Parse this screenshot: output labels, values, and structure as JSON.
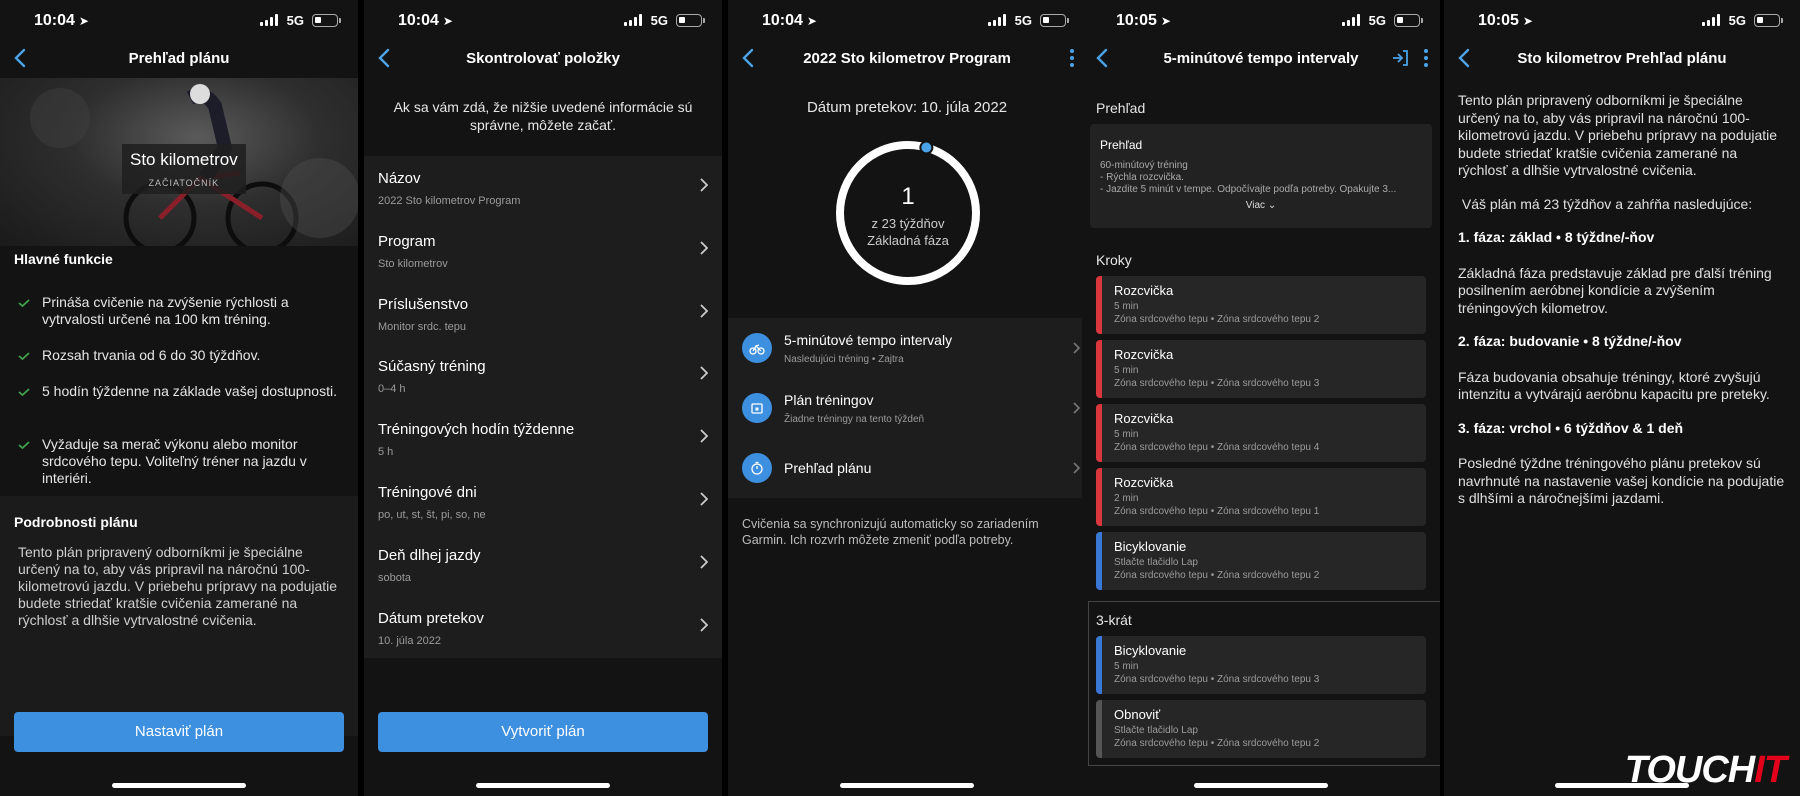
{
  "status": [
    {
      "time": "10:04",
      "net": "5G"
    },
    {
      "time": "10:04",
      "net": "5G"
    },
    {
      "time": "10:04",
      "net": "5G"
    },
    {
      "time": "10:05",
      "net": "5G"
    },
    {
      "time": "10:05",
      "net": "5G"
    }
  ],
  "accent": "#3d8fe0",
  "screen1": {
    "title": "Prehľad plánu",
    "hero_title": "Sto kilometrov",
    "hero_level": "ZAČIATOČNÍK",
    "features_heading": "Hlavné funkcie",
    "features": [
      "Prináša cvičenie na zvýšenie rýchlosti a vytrvalosti určené na 100 km tréning.",
      "Rozsah trvania od 6 do 30 týždňov.",
      "5 hodín týždenne na základe vašej dostupnosti.",
      "Vyžaduje sa merač výkonu alebo monitor srdcového tepu. Voliteľný tréner na jazdu v interiéri."
    ],
    "details_heading": "Podrobnosti plánu",
    "details_text": "Tento plán pripravený odborníkmi je špeciálne určený na to, aby vás pripravil na náročnú 100-kilometrovú jazdu. V priebehu prípravy na podujatie budete striedať kratšie cvičenia zamerané na rýchlosť a dlhšie vytrvalostné cvičenia.",
    "button": "Nastaviť plán"
  },
  "screen2": {
    "title": "Skontrolovať položky",
    "intro": "Ak sa vám zdá, že nižšie uvedené informácie sú správne, môžete začať.",
    "items": [
      {
        "label": "Názov",
        "value": "2022 Sto kilometrov Program"
      },
      {
        "label": "Program",
        "value": "Sto kilometrov"
      },
      {
        "label": "Príslušenstvo",
        "value": "Monitor srdc. tepu"
      },
      {
        "label": "Súčasný tréning",
        "value": "0–4 h"
      },
      {
        "label": "Tréningových hodín týždenne",
        "value": "5 h"
      },
      {
        "label": "Tréningové dni",
        "value": "po, ut, st, št, pi, so, ne"
      },
      {
        "label": "Deň dlhej jazdy",
        "value": "sobota"
      },
      {
        "label": "Dátum pretekov",
        "value": "10. júla 2022"
      }
    ],
    "button": "Vytvoriť plán"
  },
  "screen3": {
    "title": "2022 Sto kilometrov Program",
    "race_date": "Dátum pretekov: 10. júla 2022",
    "week": "1",
    "of_weeks": "z 23 týždňov",
    "phase": "Základná fáza",
    "progress": 0.0435,
    "rows": [
      {
        "icon": "bike-icon",
        "title": "5-minútové tempo intervaly",
        "sub": "Nasledujúci tréning  •  Zajtra"
      },
      {
        "icon": "calendar-icon",
        "title": "Plán tréningov",
        "sub": "Žiadne tréningy na tento týždeň"
      },
      {
        "icon": "stopwatch-icon",
        "title": "Prehľad plánu",
        "sub": ""
      }
    ],
    "sync_note": "Cvičenia sa synchronizujú automaticky so zariadením Garmin. Ich rozvrh môžete zmeniť podľa potreby."
  },
  "screen4": {
    "title": "5-minútové tempo intervaly",
    "overview_label": "Prehľad",
    "card_title": "Prehľad",
    "card_lines": [
      "60-minútový tréning",
      "- Rýchla rozcvička.",
      "- Jazdite 5 minút v tempe. Odpočívajte podľa potreby. Opakujte 3..."
    ],
    "more": "Viac",
    "steps_label": "Kroky",
    "steps": [
      {
        "title": "Rozcvička",
        "duration": "5 min",
        "zone": "Zóna srdcového tepu • Zóna srdcového tepu 2",
        "color": "#d9363e"
      },
      {
        "title": "Rozcvička",
        "duration": "5 min",
        "zone": "Zóna srdcového tepu • Zóna srdcového tepu 3",
        "color": "#d9363e"
      },
      {
        "title": "Rozcvička",
        "duration": "5 min",
        "zone": "Zóna srdcového tepu • Zóna srdcového tepu 4",
        "color": "#d9363e"
      },
      {
        "title": "Rozcvička",
        "duration": "2 min",
        "zone": "Zóna srdcového tepu • Zóna srdcového tepu 1",
        "color": "#d9363e"
      },
      {
        "title": "Bicyklovanie",
        "duration": "Stlačte tlačidlo Lap",
        "zone": "Zóna srdcového tepu • Zóna srdcového tepu 2",
        "color": "#3a78d6"
      }
    ],
    "repeat_label": "3-krát",
    "repeat_steps": [
      {
        "title": "Bicyklovanie",
        "duration": "5 min",
        "zone": "Zóna srdcového tepu • Zóna srdcového tepu 3",
        "color": "#3a78d6"
      },
      {
        "title": "Obnoviť",
        "duration": "Stlačte tlačidlo Lap",
        "zone": "Zóna srdcového tepu • Zóna srdcového tepu 2",
        "color": "#555555"
      }
    ]
  },
  "screen5": {
    "title": "Sto kilometrov Prehľad plánu",
    "intro": "Tento plán pripravený odborníkmi je špeciálne určený na to, aby vás pripravil na náročnú 100-kilometrovú jazdu. V priebehu prípravy na podujatie budete striedať kratšie cvičenia zamerané na rýchlosť a dlhšie vytrvalostné cvičenia.",
    "summary": " Váš plán má 23 týždňov a zahŕňa nasledujúce:",
    "phases": [
      {
        "heading": "1. fáza: základ • 8 týždne/-ňov",
        "text": "Základná fáza predstavuje základ pre ďalší tréning posilnením aeróbnej kondície a zvýšením tréningových kilometrov."
      },
      {
        "heading": "2. fáza: budovanie • 8 týždne/-ňov",
        "text": "Fáza budovania obsahuje tréningy, ktoré zvyšujú intenzitu a vytvárajú aeróbnu kapacitu pre preteky."
      },
      {
        "heading": "3. fáza: vrchol • 6 týždňov & 1 deň",
        "text": "Posledné týždne tréningového plánu pretekov sú navrhnuté na nastavenie vašej kondície na podujatie s dlhšími a náročnejšími jazdami."
      }
    ]
  },
  "watermark": {
    "part1": "TOUCH",
    "part2": "IT"
  }
}
